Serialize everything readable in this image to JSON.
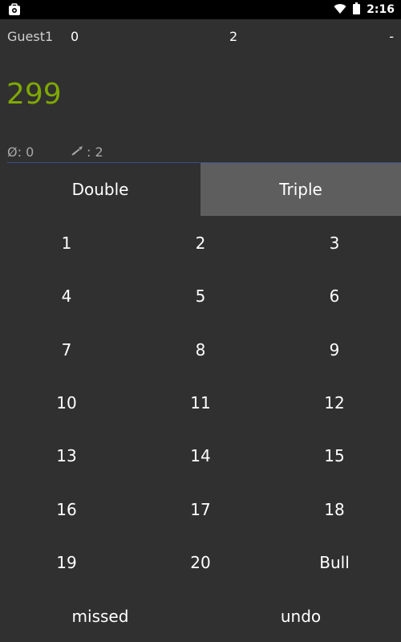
{
  "status_bar": {
    "time": "2:16"
  },
  "player": {
    "name": "Guest1",
    "legs": "0",
    "darts": "2",
    "extra": "-"
  },
  "score": "299",
  "stats": {
    "average": "Ø: 0",
    "darts_thrown": ": 2"
  },
  "multipliers": {
    "double_label": "Double",
    "triple_label": "Triple",
    "active": "triple"
  },
  "pad": {
    "buttons": [
      "1",
      "2",
      "3",
      "4",
      "5",
      "6",
      "7",
      "8",
      "9",
      "10",
      "11",
      "12",
      "13",
      "14",
      "15",
      "16",
      "17",
      "18",
      "19",
      "20",
      "Bull"
    ]
  },
  "bottom": {
    "missed_label": "missed",
    "undo_label": "undo"
  },
  "colors": {
    "background": "#303030",
    "score": "#7fa800",
    "active_toggle": "#5e5e5e",
    "divider": "#3f4a8a"
  }
}
